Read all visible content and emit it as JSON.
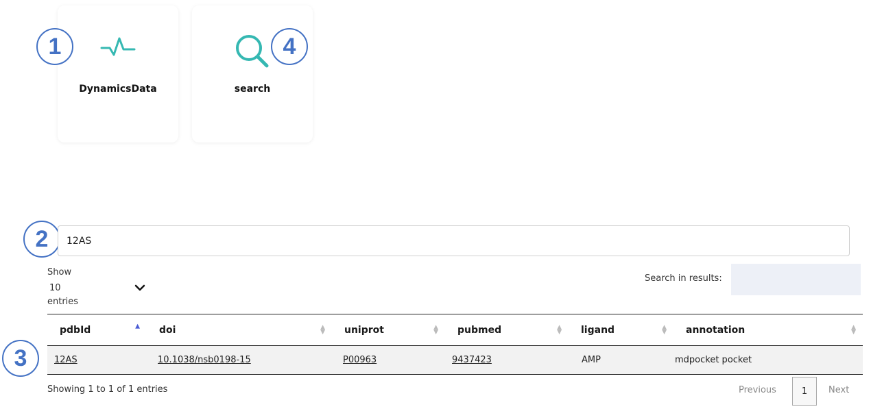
{
  "cards": [
    {
      "label": "DynamicsData",
      "icon": "activity-pulse-icon"
    },
    {
      "label": "search",
      "icon": "magnifier-icon"
    }
  ],
  "badges": [
    "1",
    "4",
    "2",
    "3"
  ],
  "search": {
    "value": "12AS"
  },
  "length": {
    "show": "Show",
    "value": "10",
    "entries": "entries"
  },
  "results_search": {
    "label": "Search in results:"
  },
  "table": {
    "headers": [
      "pdbId",
      "doi",
      "uniprot",
      "pubmed",
      "ligand",
      "annotation"
    ],
    "rows": [
      [
        "12AS",
        "10.1038/nsb0198-15",
        "P00963",
        "9437423",
        "AMP",
        "mdpocket pocket"
      ]
    ]
  },
  "info": "Showing 1 to 1 of 1 entries",
  "pagination": {
    "previous": "Previous",
    "current": "1",
    "next": "Next"
  },
  "colors": {
    "accent_teal": "#35b8b2",
    "badge_blue": "#4472c4",
    "sort_active": "#4a5bd4"
  }
}
